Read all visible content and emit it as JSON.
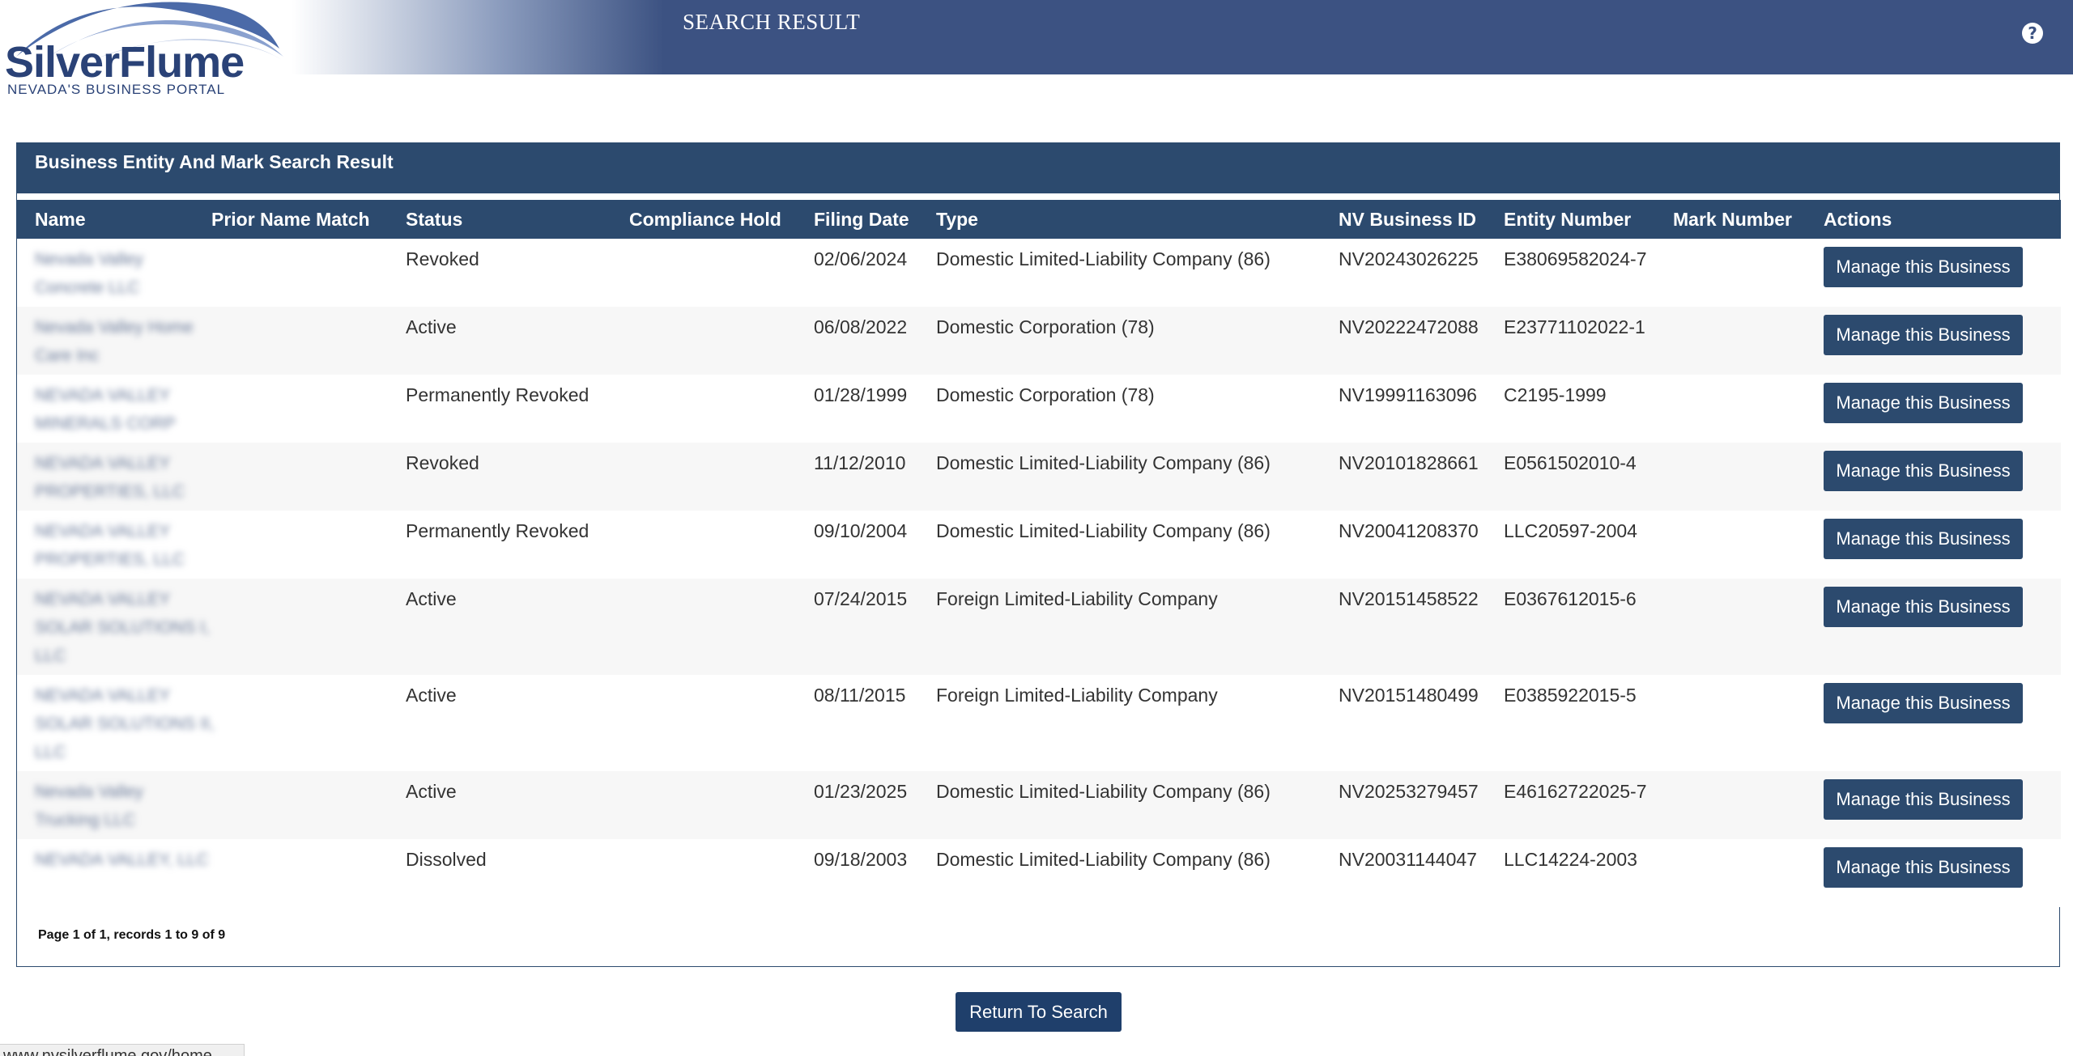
{
  "header": {
    "logo_name": "SilverFlume",
    "logo_sub": "NEVADA'S BUSINESS PORTAL",
    "page_title": "SEARCH RESULT",
    "help_glyph": "?"
  },
  "panel": {
    "title": "Business Entity And Mark Search Result",
    "columns": [
      "Name",
      "Prior Name Match",
      "Status",
      "Compliance Hold",
      "Filing Date",
      "Type",
      "NV Business ID",
      "Entity Number",
      "Mark Number",
      "Actions"
    ],
    "rows": [
      {
        "name_l1": "Nevada Valley",
        "name_l2": "Concrete LLC",
        "name_l3": "",
        "status": "Revoked",
        "filing_date": "02/06/2024",
        "type": "Domestic Limited-Liability Company (86)",
        "nv_id": "NV20243026225",
        "entity_number": "E38069582024-7",
        "action": "Manage this Business"
      },
      {
        "name_l1": "Nevada Valley Home",
        "name_l2": "Care Inc",
        "name_l3": "",
        "status": "Active",
        "filing_date": "06/08/2022",
        "type": "Domestic Corporation (78)",
        "nv_id": "NV20222472088",
        "entity_number": "E23771102022-1",
        "action": "Manage this Business"
      },
      {
        "name_l1": "NEVADA VALLEY",
        "name_l2": "MINERALS CORP",
        "name_l3": "",
        "status": "Permanently Revoked",
        "filing_date": "01/28/1999",
        "type": "Domestic Corporation (78)",
        "nv_id": "NV19991163096",
        "entity_number": "C2195-1999",
        "action": "Manage this Business"
      },
      {
        "name_l1": "NEVADA VALLEY",
        "name_l2": "PROPERTIES, LLC",
        "name_l3": "",
        "status": "Revoked",
        "filing_date": "11/12/2010",
        "type": "Domestic Limited-Liability Company (86)",
        "nv_id": "NV20101828661",
        "entity_number": "E0561502010-4",
        "action": "Manage this Business"
      },
      {
        "name_l1": "NEVADA VALLEY",
        "name_l2": "PROPERTIES, LLC",
        "name_l3": "",
        "status": "Permanently Revoked",
        "filing_date": "09/10/2004",
        "type": "Domestic Limited-Liability Company (86)",
        "nv_id": "NV20041208370",
        "entity_number": "LLC20597-2004",
        "action": "Manage this Business"
      },
      {
        "name_l1": "NEVADA VALLEY",
        "name_l2": "SOLAR SOLUTIONS I,",
        "name_l3": "LLC",
        "status": "Active",
        "filing_date": "07/24/2015",
        "type": "Foreign Limited-Liability Company",
        "nv_id": "NV20151458522",
        "entity_number": "E0367612015-6",
        "action": "Manage this Business"
      },
      {
        "name_l1": "NEVADA VALLEY",
        "name_l2": "SOLAR SOLUTIONS II,",
        "name_l3": "LLC",
        "status": "Active",
        "filing_date": "08/11/2015",
        "type": "Foreign Limited-Liability Company",
        "nv_id": "NV20151480499",
        "entity_number": "E0385922015-5",
        "action": "Manage this Business"
      },
      {
        "name_l1": "Nevada Valley",
        "name_l2": "Trucking LLC",
        "name_l3": "",
        "status": "Active",
        "filing_date": "01/23/2025",
        "type": "Domestic Limited-Liability Company (86)",
        "nv_id": "NV20253279457",
        "entity_number": "E46162722025-7",
        "action": "Manage this Business"
      },
      {
        "name_l1": "NEVADA VALLEY, LLC",
        "name_l2": "",
        "name_l3": "",
        "status": "Dissolved",
        "filing_date": "09/18/2003",
        "type": "Domestic Limited-Liability Company (86)",
        "nv_id": "NV20031144047",
        "entity_number": "LLC14224-2003",
        "action": "Manage this Business"
      }
    ],
    "pager": "Page 1 of 1, records 1 to 9 of 9"
  },
  "return_button": "Return To Search",
  "status_url": "www.nvsilverflume.gov/home",
  "colors": {
    "navy": "#2c4a6e",
    "header_blue": "#3c5282"
  }
}
